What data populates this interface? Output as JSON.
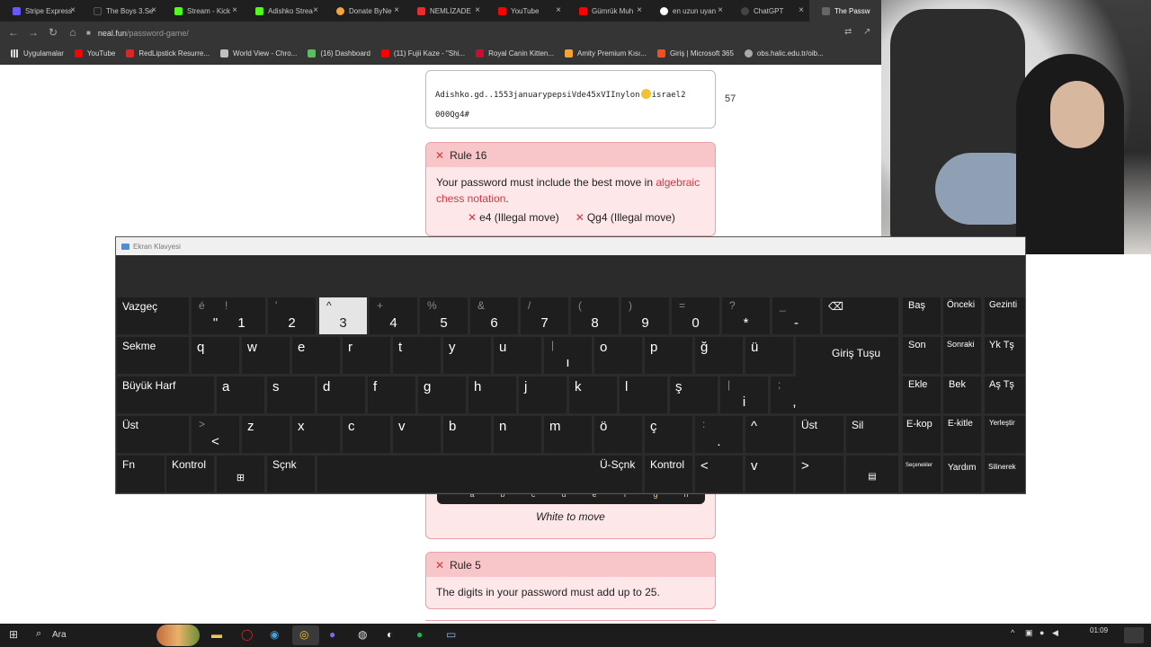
{
  "browser": {
    "tabs": [
      {
        "title": "Stripe Express",
        "color": "#635bff"
      },
      {
        "title": "The Boys 3.Se",
        "color": "#222222"
      },
      {
        "title": "Stream - Kick",
        "color": "#53fc18"
      },
      {
        "title": "Adishko Strea",
        "color": "#53fc18"
      },
      {
        "title": "Donate ByNe",
        "color": "#f2a33a"
      },
      {
        "title": "NEMLİZADE",
        "color": "#e52e2e"
      },
      {
        "title": "YouTube",
        "color": "#ff0000"
      },
      {
        "title": "Gümrük Muh",
        "color": "#ff0000"
      },
      {
        "title": "en uzun uyan",
        "color": "#ffffff"
      },
      {
        "title": "ChatGPT",
        "color": "#444444"
      },
      {
        "title": "The Passw",
        "color": "#666666"
      }
    ],
    "url_domain": "neal.fun",
    "url_path": "/password-game/",
    "bookmarks": [
      {
        "label": "Uygulamalar",
        "color": "#dddddd"
      },
      {
        "label": "YouTube",
        "color": "#ff0000"
      },
      {
        "label": "RedLipstick Resurre...",
        "color": "#d62828"
      },
      {
        "label": "World View - Chro...",
        "color": "#c0c0c0"
      },
      {
        "label": "(16) Dashboard",
        "color": "#5dbb63"
      },
      {
        "label": "(11) Fujii Kaze - \"Shi...",
        "color": "#ff0000"
      },
      {
        "label": "Royal Canin Kitten...",
        "color": "#c8102e"
      },
      {
        "label": "Amity Premium Kısı...",
        "color": "#f2a33a"
      },
      {
        "label": "Giriş | Microsoft 365",
        "color": "#f25022"
      },
      {
        "label": "obs.halic.edu.tr/oib...",
        "color": "#aaaaaa"
      }
    ]
  },
  "password": {
    "line1a": "Adishko.gd..1553januarypepsiVde45xVIInylon",
    "line1b": "israel2",
    "line2": "000Qg4#",
    "count": "57"
  },
  "rules": {
    "rule16": {
      "title": "Rule 16",
      "text": "Your password must include the best move in",
      "link": "algebraic chess notation",
      "period": ".",
      "moves": [
        "e4 (Illegal move)",
        "Qg4 (Illegal move)"
      ],
      "files": [
        "a",
        "b",
        "c",
        "d",
        "e",
        "f",
        "g",
        "h"
      ],
      "to_move": "White to move"
    },
    "rule5": {
      "title": "Rule 5",
      "text": "The digits in your password must add up to 25."
    }
  },
  "osk": {
    "title": "Ekran Klavyesi",
    "keys": {
      "esc": "Vazgeç",
      "k_e_top": "é",
      "k_e_bot": "\"",
      "k1s": "!",
      "k1": "1",
      "k2s": "'",
      "k2": "2",
      "k3s": "^",
      "k3": "3",
      "k4s": "+",
      "k4": "4",
      "k5s": "%",
      "k5": "5",
      "k6s": "&",
      "k6": "6",
      "k7s": "/",
      "k7": "7",
      "k8s": "(",
      "k8": "8",
      "k9s": ")",
      "k9": "9",
      "k0s": "=",
      "k0": "0",
      "kqs": "?",
      "kq": "*",
      "kds": "_",
      "kd": "-",
      "backspace": "⌫",
      "tab": "Sekme",
      "q": "q",
      "w": "w",
      "e": "e",
      "r": "r",
      "t": "t",
      "y": "y",
      "u": "u",
      "ib": "|",
      "i_dotless": "ı",
      "o": "o",
      "p": "p",
      "gg": "ğ",
      "uu": "ü",
      "enter": "Giriş Tuşu",
      "caps": "Büyük Harf",
      "a": "a",
      "s": "s",
      "d": "d",
      "f": "f",
      "g": "g",
      "h": "h",
      "j": "j",
      "k": "k",
      "l": "l",
      "ss": "ş",
      "i_top": "|",
      "i": "i",
      "semi": ";",
      "comma": ",",
      "shift": "Üst",
      "lt_top": ">",
      "lt": "<",
      "z": "z",
      "x": "x",
      "c": "c",
      "v": "v",
      "b": "b",
      "n": "n",
      "m": "m",
      "oo": "ö",
      "cc": "ç",
      "dot_top": ":",
      "dot": ".",
      "up": "^",
      "rshift": "Üst",
      "del": "Sil",
      "fn": "Fn",
      "ctrl": "Kontrol",
      "win": "⊞",
      "alt": "Sçnk",
      "altgr": "Ü-Sçnk",
      "rctrl": "Kontrol",
      "left": "<",
      "down": "v",
      "right": ">",
      "menu": "▤",
      "home": "Baş",
      "pgup": "Önceki",
      "nav": "Gezinti",
      "end": "Son",
      "pgdn": "Sonraki",
      "scroll": "Yk Tş",
      "ins": "Ekle",
      "pause": "Bek",
      "up2": "Aş Tş",
      "prtscn": "E-kop",
      "ecut": "E-kitle",
      "dock": "Yerleştir",
      "options": "Seçenekler",
      "help": "Yardım",
      "fade": "Silinerek"
    }
  },
  "taskbar": {
    "search": "Ara",
    "time": "01:09"
  }
}
